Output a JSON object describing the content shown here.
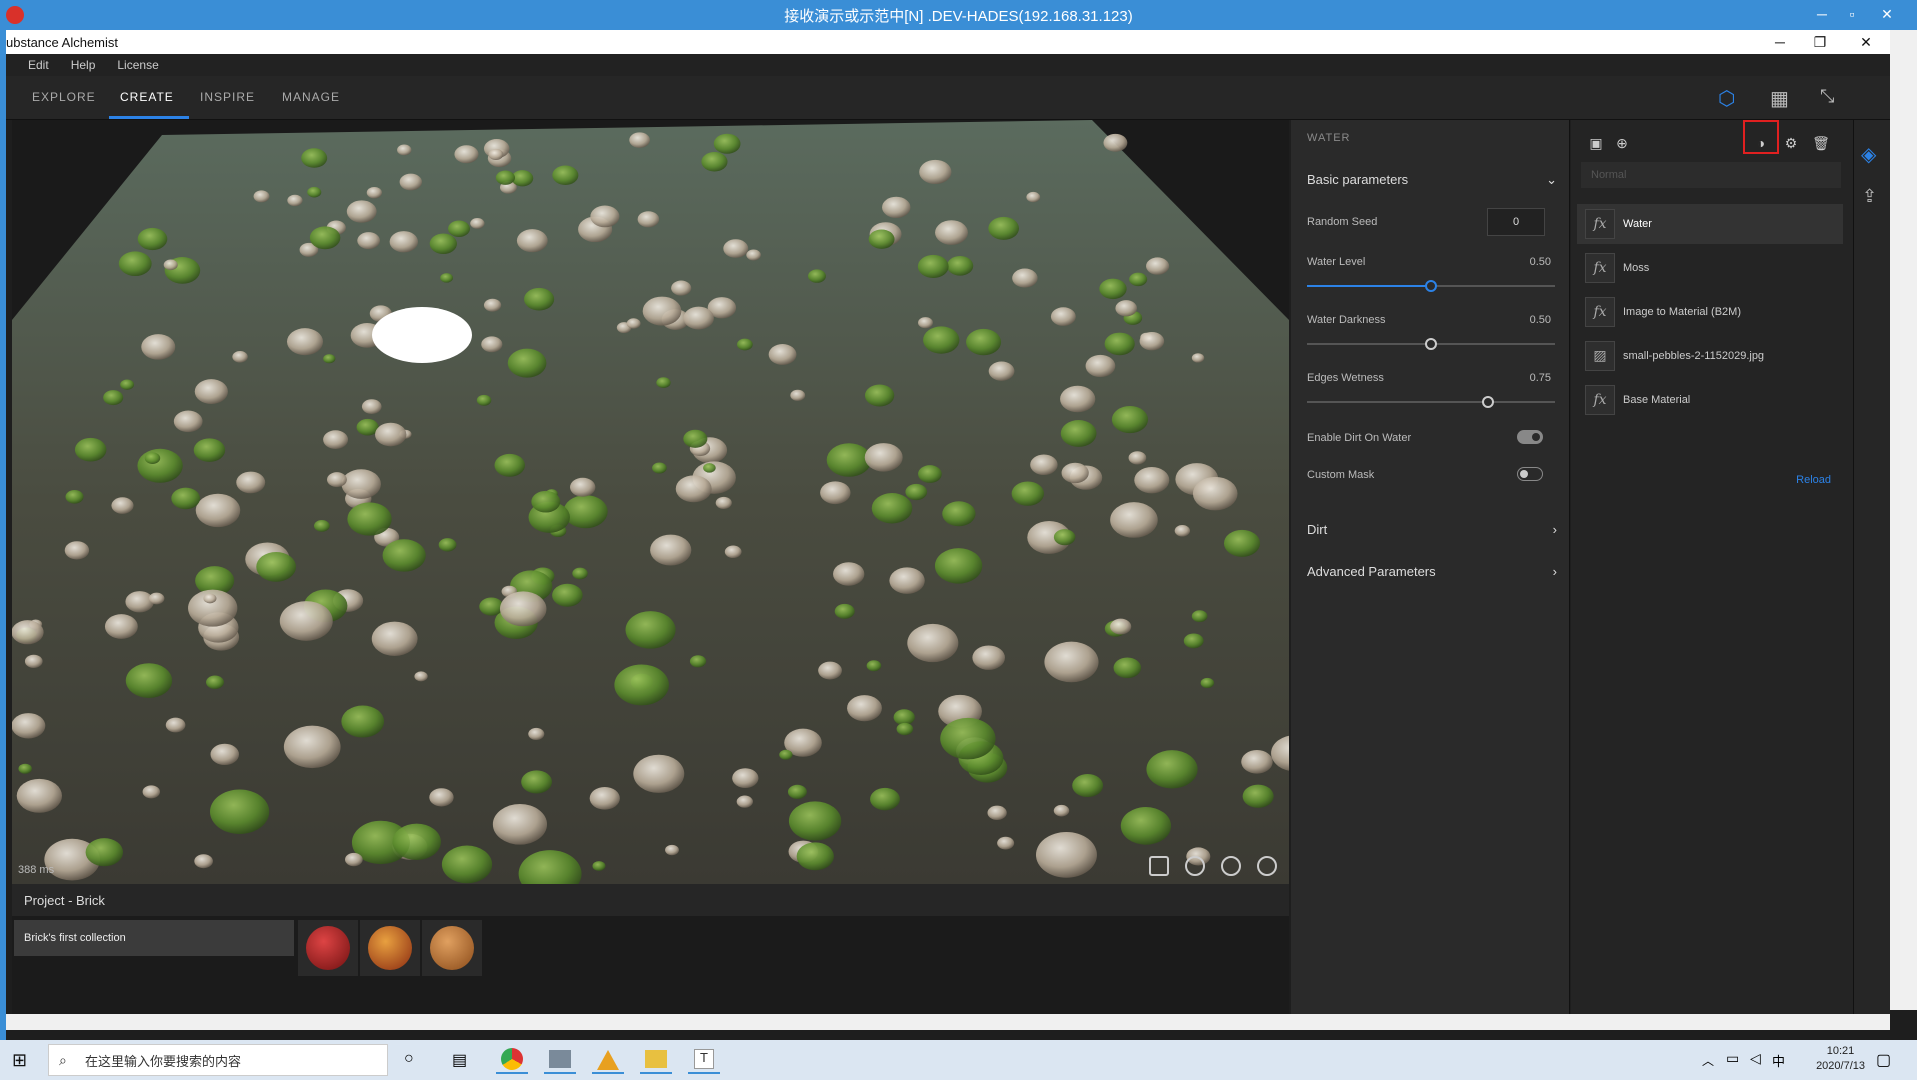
{
  "remote": {
    "title": "接收演示或示范中[N] .DEV-HADES(192.168.31.123)"
  },
  "window": {
    "title": "ubstance Alchemist"
  },
  "menu": [
    "Edit",
    "Help",
    "License"
  ],
  "tabs": [
    "EXPLORE",
    "CREATE",
    "INSPIRE",
    "MANAGE"
  ],
  "active_tab": "CREATE",
  "viewport": {
    "render_time": "388 ms"
  },
  "project": {
    "title": "Project - Brick",
    "collection": "Brick's first collection"
  },
  "params": {
    "title": "WATER",
    "basic": "Basic parameters",
    "random_seed_label": "Random Seed",
    "random_seed_value": "0",
    "water_level_label": "Water Level",
    "water_level_value": "0.50",
    "water_darkness_label": "Water Darkness",
    "water_darkness_value": "0.50",
    "edges_wetness_label": "Edges Wetness",
    "edges_wetness_value": "0.75",
    "enable_dirt_label": "Enable Dirt On Water",
    "enable_dirt_on": true,
    "custom_mask_label": "Custom Mask",
    "custom_mask_on": false,
    "dirt": "Dirt",
    "advanced": "Advanced Parameters"
  },
  "layers": {
    "blend_mode": "Normal",
    "items": [
      "Water",
      "Moss",
      "Image to Material (B2M)",
      "small-pebbles-2-1152029.jpg",
      "Base Material"
    ],
    "reload": "Reload"
  },
  "taskbar": {
    "search_placeholder": "在这里输入你要搜索的内容",
    "time": "10:21",
    "date": "2020/7/13",
    "ime": "中"
  }
}
